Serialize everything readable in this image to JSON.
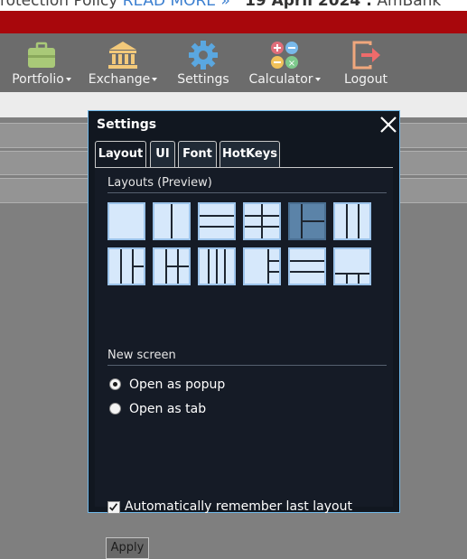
{
  "ticker": {
    "text_1": "rotection Policy",
    "link": "READ MORE »",
    "text_2": "19 April 2024 :",
    "text_3": "AmBank"
  },
  "toolbar": {
    "items": [
      {
        "label": "Portfolio",
        "icon": "briefcase-icon",
        "dropdown": true
      },
      {
        "label": "Exchange",
        "icon": "bank-icon",
        "dropdown": true
      },
      {
        "label": "Settings",
        "icon": "gear-icon",
        "dropdown": false
      },
      {
        "label": "Calculator",
        "icon": "calculator-icon",
        "dropdown": true
      },
      {
        "label": "Logout",
        "icon": "logout-icon",
        "dropdown": false
      }
    ]
  },
  "dialog": {
    "title": "Settings",
    "tabs": [
      "Layout",
      "UI",
      "Font",
      "HotKeys"
    ],
    "active_tab": "Layout",
    "layouts_title": "Layouts (Preview)",
    "selected_layout": 5,
    "new_screen_title": "New screen",
    "options": [
      "Open as popup",
      "Open as tab"
    ],
    "selected_option": "Open as popup",
    "remember_label": "Automatically remember last layout",
    "remember_checked": true,
    "apply_label": "Apply"
  },
  "colors": {
    "header_red": "#a8070c",
    "toolbar": "#6c6c6c",
    "dialog_bg": "#111720",
    "dialog_border": "#6fb7e8",
    "layout_tile": "#d6e8fb",
    "layout_selected": "#5b83a8"
  }
}
